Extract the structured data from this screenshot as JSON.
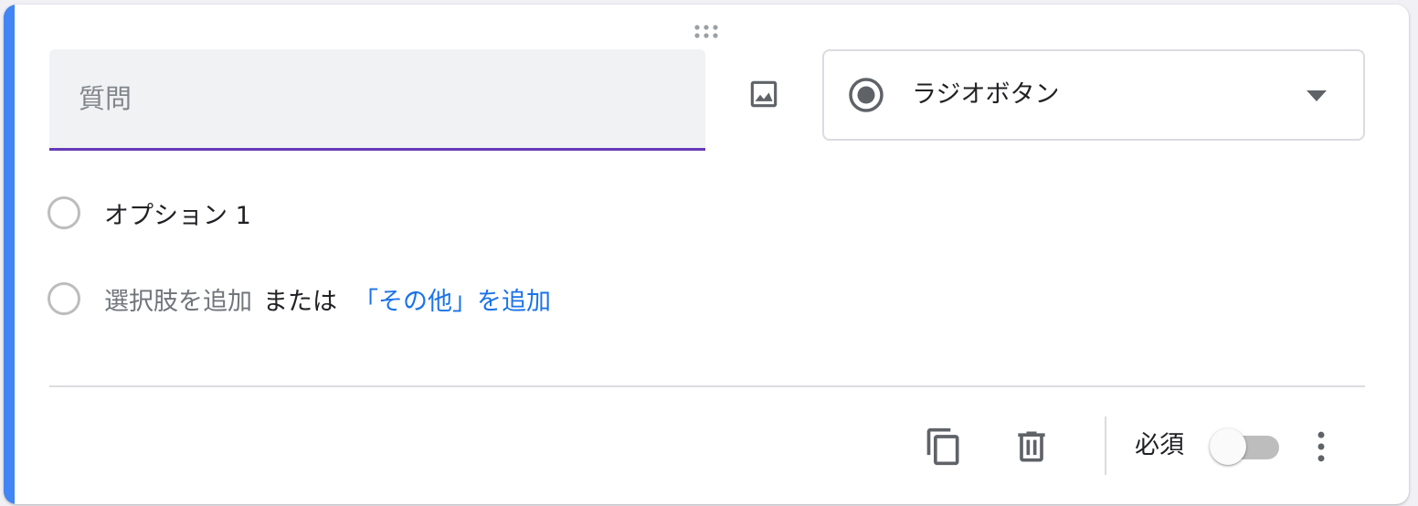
{
  "question": {
    "placeholder": "質問",
    "value": ""
  },
  "question_type": {
    "label": "ラジオボタン",
    "icon": "radio-button-checked-icon"
  },
  "options": [
    {
      "label": "オプション 1"
    }
  ],
  "add_option": {
    "label": "選択肢を追加",
    "or": "または",
    "add_other": "「その他」を追加"
  },
  "footer": {
    "copy_icon": "content-copy-icon",
    "delete_icon": "trash-icon",
    "required_label": "必須",
    "required_on": false,
    "more_icon": "more-vert-icon"
  },
  "colors": {
    "accent": "#4285f4",
    "focus_underline": "#673ab7",
    "link": "#1a73e8",
    "icon": "#5f6368"
  }
}
